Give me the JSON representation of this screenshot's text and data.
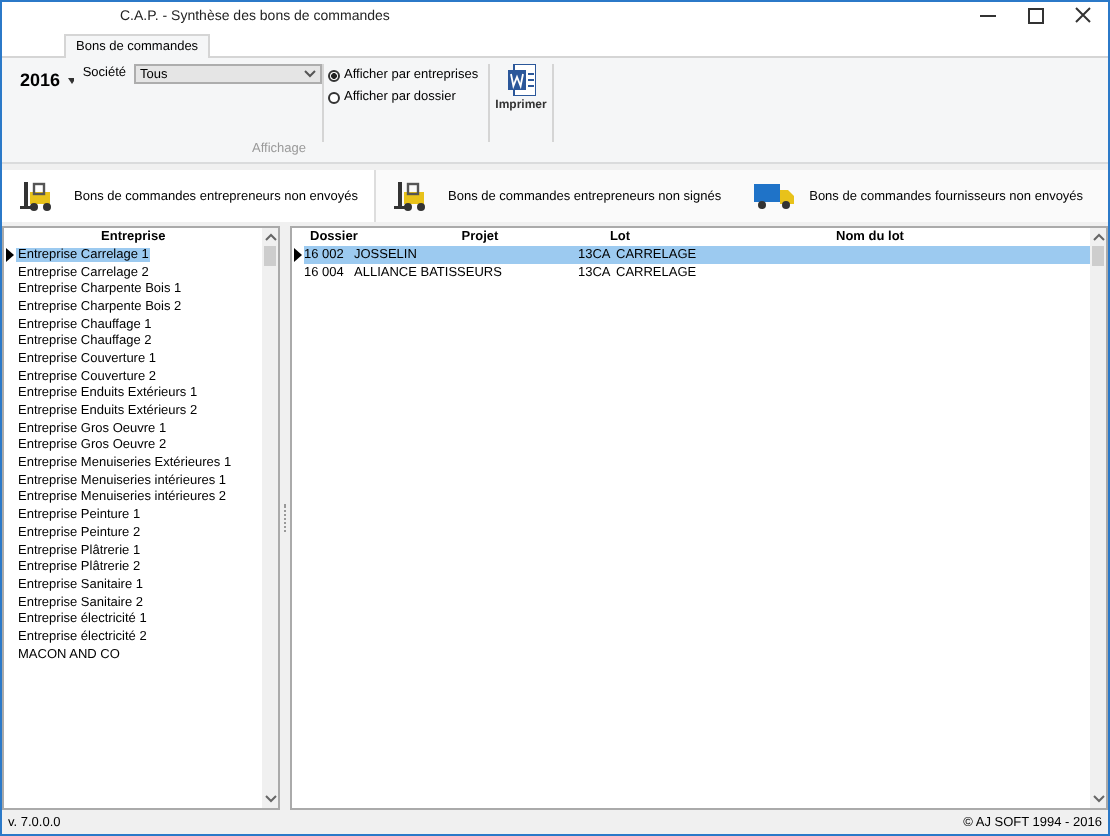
{
  "window": {
    "title": "C.A.P. - Synthèse des bons de commandes"
  },
  "tabs": [
    {
      "label": "Bons de commandes",
      "selected": true
    }
  ],
  "ribbon": {
    "year": "2016",
    "societe_label": "Société",
    "societe_value": "Tous",
    "display_options": [
      {
        "label": "Afficher par entreprises",
        "selected": true
      },
      {
        "label": "Afficher par dossier",
        "selected": false
      }
    ],
    "group_label": "Affichage",
    "print_button": "Imprimer"
  },
  "toolbar": [
    {
      "label": "Bons de commandes entrepreneurs non envoyés",
      "kind": "forklift"
    },
    {
      "label": "Bons de commandes entrepreneurs non signés",
      "kind": "forklift"
    },
    {
      "label": "Bons de commandes fournisseurs non envoyés",
      "kind": "truck"
    }
  ],
  "companies": {
    "column": "Entreprise",
    "rows": [
      {
        "name": "Entreprise Carrelage 1",
        "selected": true
      },
      {
        "name": "Entreprise Carrelage 2",
        "selected": false
      },
      {
        "name": "Entreprise Charpente Bois 1",
        "selected": false
      },
      {
        "name": "Entreprise Charpente Bois 2",
        "selected": false
      },
      {
        "name": "Entreprise Chauffage 1",
        "selected": false
      },
      {
        "name": "Entreprise Chauffage 2",
        "selected": false
      },
      {
        "name": "Entreprise Couverture 1",
        "selected": false
      },
      {
        "name": "Entreprise Couverture 2",
        "selected": false
      },
      {
        "name": "Entreprise Enduits Extérieurs 1",
        "selected": false
      },
      {
        "name": "Entreprise Enduits Extérieurs 2",
        "selected": false
      },
      {
        "name": "Entreprise Gros Oeuvre 1",
        "selected": false
      },
      {
        "name": "Entreprise Gros Oeuvre 2",
        "selected": false
      },
      {
        "name": "Entreprise Menuiseries Extérieures 1",
        "selected": false
      },
      {
        "name": "Entreprise Menuiseries intérieures 1",
        "selected": false
      },
      {
        "name": "Entreprise Menuiseries intérieures 2",
        "selected": false
      },
      {
        "name": "Entreprise Peinture 1",
        "selected": false
      },
      {
        "name": "Entreprise Peinture 2",
        "selected": false
      },
      {
        "name": "Entreprise Plâtrerie 1",
        "selected": false
      },
      {
        "name": "Entreprise Plâtrerie 2",
        "selected": false
      },
      {
        "name": "Entreprise Sanitaire 1",
        "selected": false
      },
      {
        "name": "Entreprise Sanitaire 2",
        "selected": false
      },
      {
        "name": "Entreprise électricité 1",
        "selected": false
      },
      {
        "name": "Entreprise électricité 2",
        "selected": false
      },
      {
        "name": "MACON AND CO",
        "selected": false
      }
    ]
  },
  "orders": {
    "columns": [
      "Dossier",
      "Projet",
      "Lot",
      "Nom du lot"
    ],
    "rows": [
      {
        "dossier": "16 002",
        "projet": "JOSSELIN",
        "lot": "13CA",
        "lot_name": "CARRELAGE",
        "selected": true
      },
      {
        "dossier": "16 004",
        "projet": "ALLIANCE BATISSEURS",
        "lot": "13CA",
        "lot_name": "CARRELAGE",
        "selected": false
      }
    ]
  },
  "status_bar": {
    "version": "v. 7.0.0.0",
    "copyright": "© AJ SOFT 1994 - 2016"
  }
}
